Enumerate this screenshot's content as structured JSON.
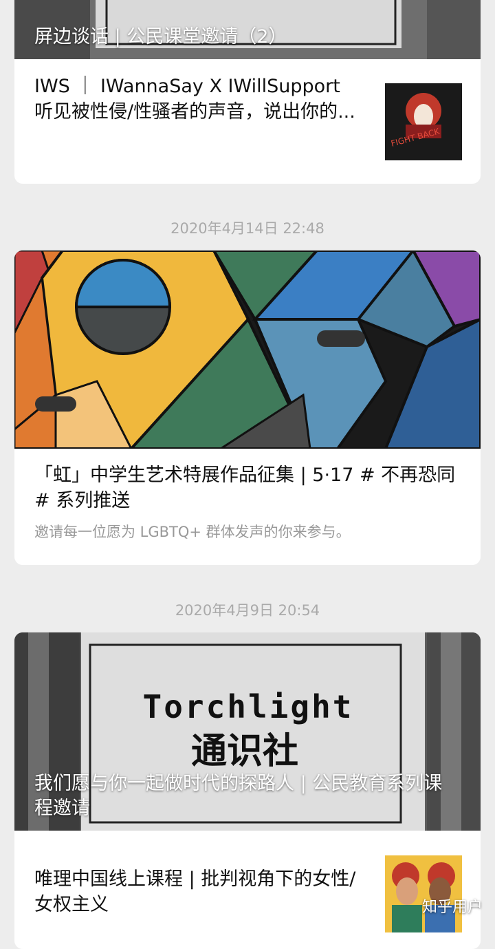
{
  "card1": {
    "overlay_title": "屏边谈话 | 公民课堂邀请（2）",
    "item_title": "IWS ｜ IWannaSay X IWillSupport 听见被性侵/性骚者的声音，说出你的...",
    "thumb_text": "FIGHT BACK"
  },
  "timestamps": [
    "2020年4月14日 22:48",
    "2020年4月9日 20:54"
  ],
  "card2": {
    "title": "「虹」中学生艺术特展作品征集 | 5·17 # 不再恐同 # 系列推送",
    "subtitle": "邀请每一位愿为 LGBTQ+ 群体发声的你来参与。"
  },
  "card3": {
    "banner_text_en": "Torchlight",
    "banner_text_cn": "通识社",
    "overlay_title": "我们愿与你一起做时代的探路人 | 公民教育系列课程邀请",
    "item_title": "唯理中国线上课程 | 批判视角下的女性/女权主义"
  },
  "watermark": "知乎用户"
}
